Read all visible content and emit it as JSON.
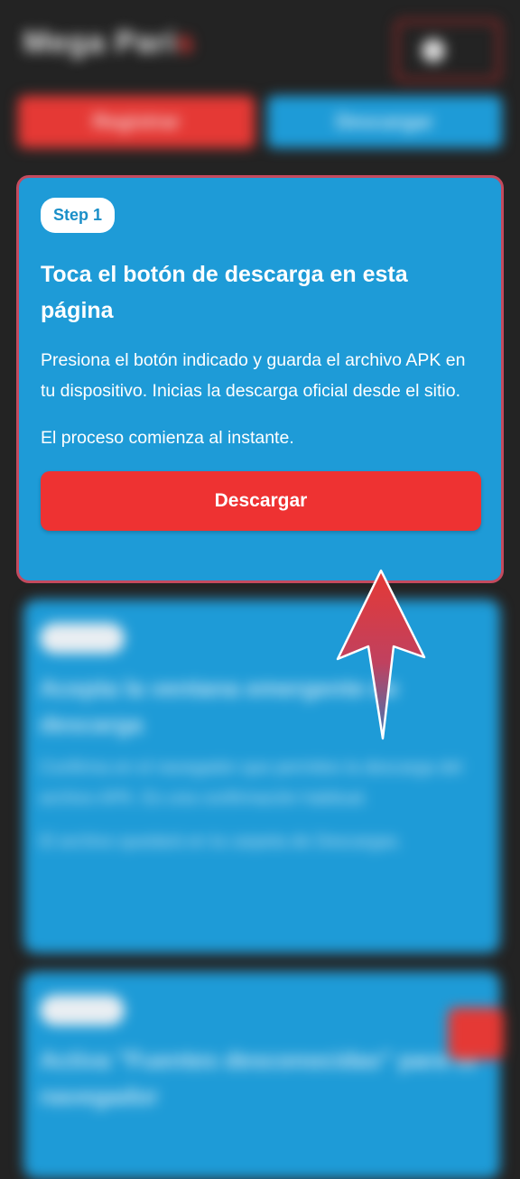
{
  "background": {
    "logo_part1": "Mega",
    "logo_part2": "Pari",
    "logo_accent": "s",
    "nav_left_label": "Registrar",
    "nav_right_label": "Descargar",
    "card2": {
      "badge": "Step 2",
      "title": "Acepta la ventana emergente de descarga",
      "desc": "Confirma en el navegador que permites la descarga del archivo APK. Es una confirmación habitual.",
      "note": "El archivo quedará en la carpeta de Descargas."
    },
    "card3": {
      "badge": "Step 3",
      "title": "Activa \"Fuentes desconocidas\" para tu navegador"
    }
  },
  "card": {
    "badge": "Step 1",
    "title": "Toca el botón de descarga en esta página",
    "description": "Presiona el botón indicado y guarda el archivo APK en tu dispositivo. Inicias la descarga oficial desde el sitio.",
    "note": "El proceso comienza al instante.",
    "button_label": "Descargar"
  },
  "colors": {
    "card_bg": "#1e9bd7",
    "button_red": "#ee3232",
    "page_bg": "#232323",
    "arrow_red": "#e53935"
  },
  "icons": {
    "pointer": "arrow-up-icon",
    "menu": "user-menu-icon"
  }
}
